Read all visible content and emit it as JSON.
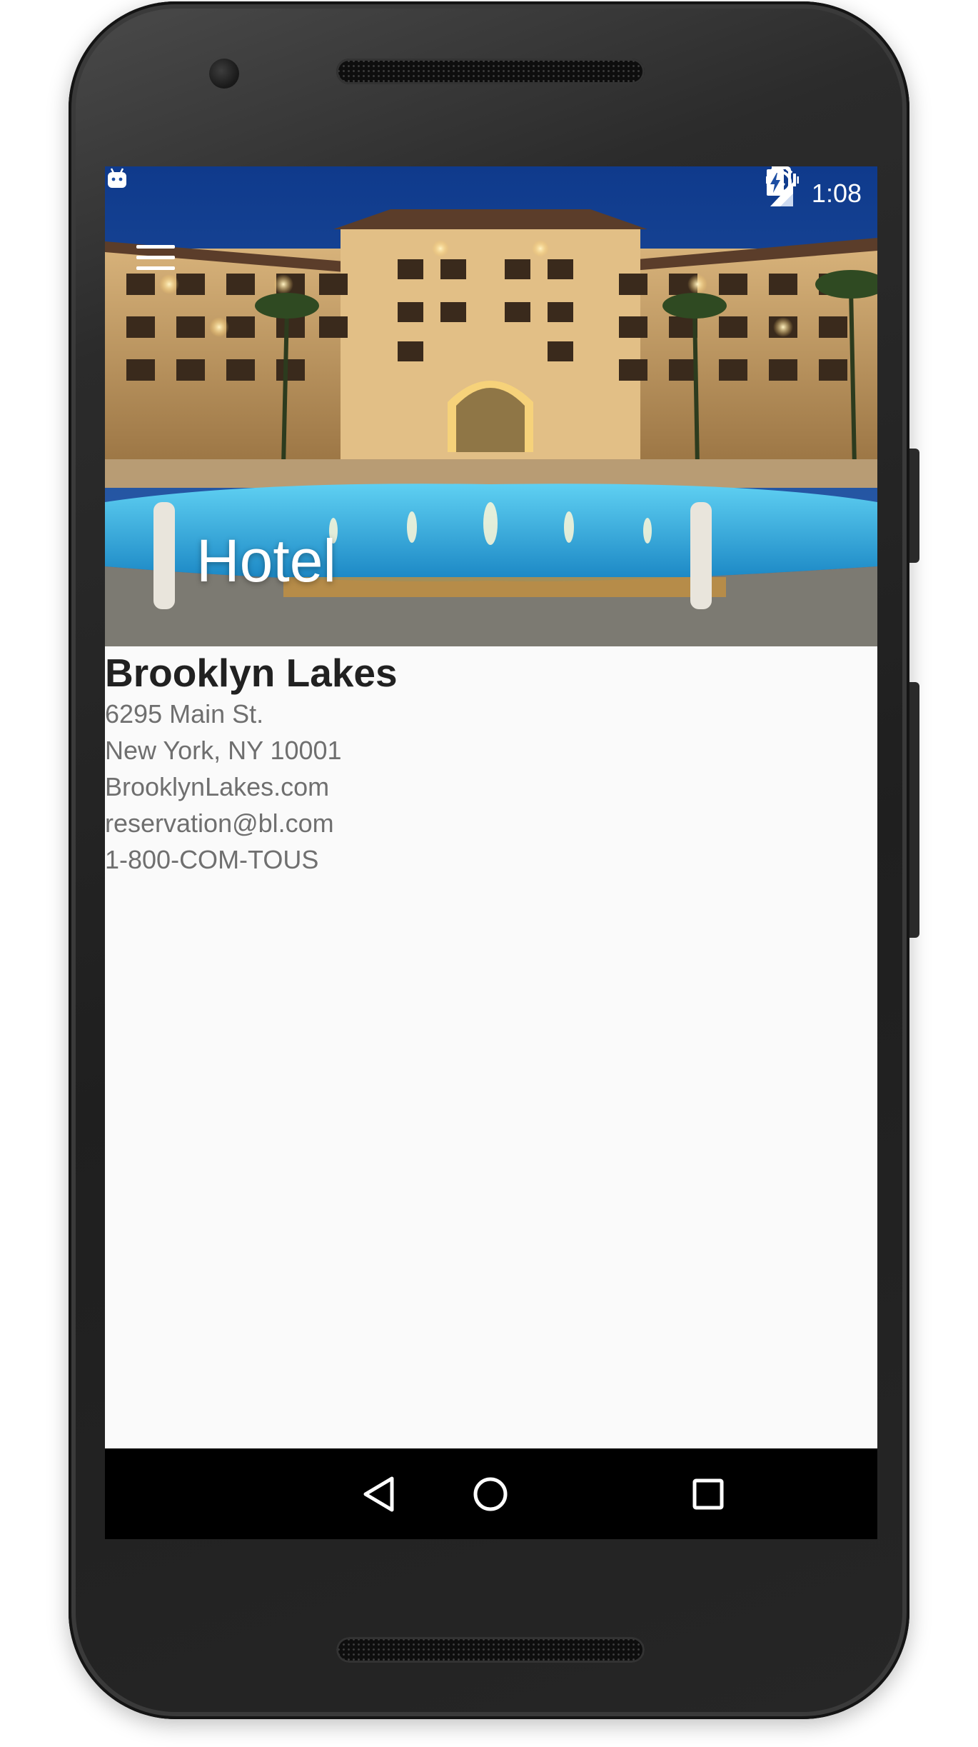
{
  "status_bar": {
    "time": "1:08",
    "network_label": "H",
    "icons": [
      "android-debug-icon",
      "vibrate-icon",
      "alarm-icon",
      "signal-icon",
      "battery-charging-icon"
    ]
  },
  "toolbar": {
    "menu_icon": "hamburger-menu-icon",
    "title": "Hotel"
  },
  "hotel": {
    "name": "Brooklyn Lakes",
    "address_line1": "6295 Main St.",
    "address_line2": "New York, NY 10001",
    "website": "BrooklynLakes.com",
    "email": "reservation@bl.com",
    "phone": "1-800-COM-TOUS"
  },
  "nav_bar": {
    "icons": [
      "back-icon",
      "home-icon",
      "recents-icon"
    ]
  },
  "colors": {
    "status_text": "#ffffff",
    "title_text": "#ffffff",
    "name_text": "#212121",
    "detail_text": "#6f6f6f",
    "screen_background": "#fafafa",
    "nav_bar_background": "#000000"
  }
}
